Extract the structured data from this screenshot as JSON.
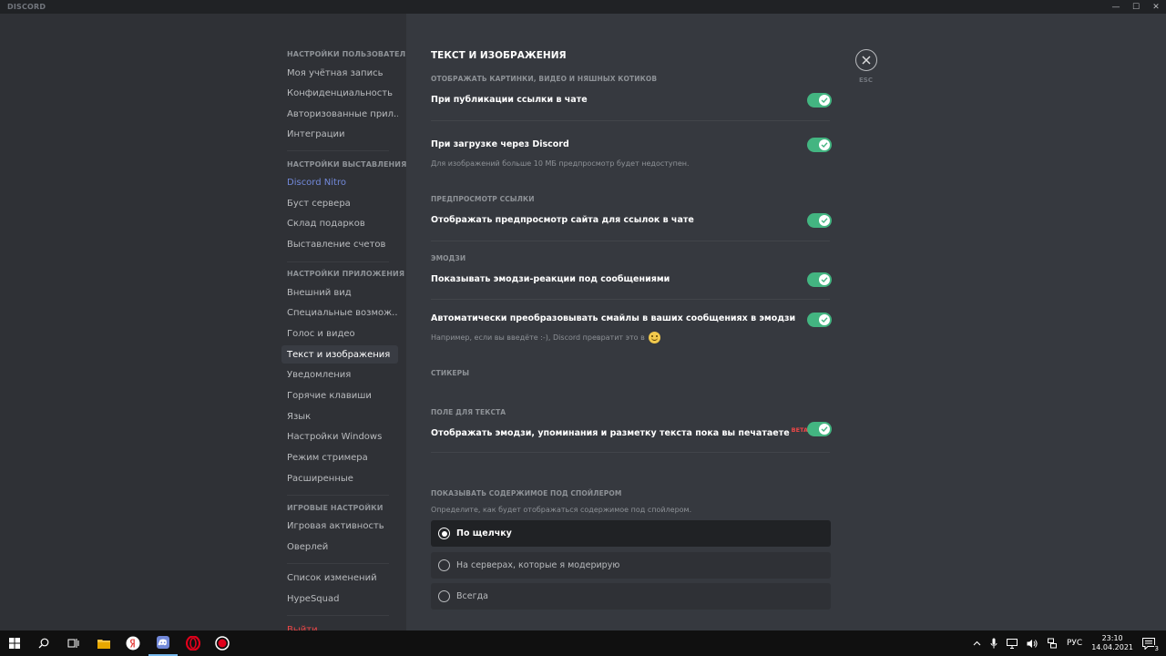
{
  "window": {
    "title": "DISCORD",
    "minimize": "—",
    "maximize": "☐",
    "close": "✕"
  },
  "sidebar": {
    "sections": [
      {
        "header": "Настройки пользователя",
        "items": [
          "Моя учётная запись",
          "Конфиденциальность",
          "Авторизованные прил...",
          "Интеграции"
        ]
      },
      {
        "header": "Настройки выставления...",
        "items": [
          "Discord Nitro",
          "Буст сервера",
          "Склад подарков",
          "Выставление счетов"
        ]
      },
      {
        "header": "Настройки приложения",
        "items": [
          "Внешний вид",
          "Специальные возмож...",
          "Голос и видео",
          "Текст и изображения",
          "Уведомления",
          "Горячие клавиши",
          "Язык",
          "Настройки Windows",
          "Режим стримера",
          "Расширенные"
        ]
      },
      {
        "header": "Игровые настройки",
        "items": [
          "Игровая активность",
          "Оверлей"
        ]
      },
      {
        "header": "",
        "items": [
          "Список изменений",
          "HypeSquad"
        ]
      }
    ],
    "selected": "Текст и изображения",
    "logout": "Выйти"
  },
  "content": {
    "page_title": "Текст и изображения",
    "close_label": "ESC",
    "sections": {
      "display_media": {
        "title": "Отображать картинки, видео и няшных котиков",
        "on_link": {
          "label": "При публикации ссылки в чате",
          "enabled": true
        },
        "on_upload": {
          "label": "При загрузке через Discord",
          "enabled": true,
          "note": "Для изображений больше 10 МБ предпросмотр будет недоступен."
        }
      },
      "link_preview": {
        "title": "Предпросмотр ссылки",
        "show_preview": {
          "label": "Отображать предпросмотр сайта для ссылок в чате",
          "enabled": true
        }
      },
      "emoji": {
        "title": "Эмодзи",
        "reactions": {
          "label": "Показывать эмодзи-реакции под сообщениями",
          "enabled": true
        },
        "convert": {
          "label": "Автоматически преобразовывать смайлы в ваших сообщениях в эмодзи",
          "enabled": true,
          "note": "Например, если вы введёте :-), Discord превратит это в"
        }
      },
      "stickers": {
        "title": "Стикеры"
      },
      "text_box": {
        "title": "Поле для текста",
        "preview": {
          "label": "Отображать эмодзи, упоминания и разметку текста пока вы печатаете",
          "badge": "BETA",
          "enabled": true
        }
      },
      "spoilers": {
        "title": "Показывать содержимое под спойлером",
        "description": "Определите, как будет отображаться содержимое под спойлером.",
        "options": [
          "По щелчку",
          "На серверах, которые я модерирую",
          "Всегда"
        ],
        "selected": "По щелчку"
      }
    }
  },
  "taskbar": {
    "language": "РУС",
    "time": "23:10",
    "date": "14.04.2021",
    "notification_count": "3"
  }
}
